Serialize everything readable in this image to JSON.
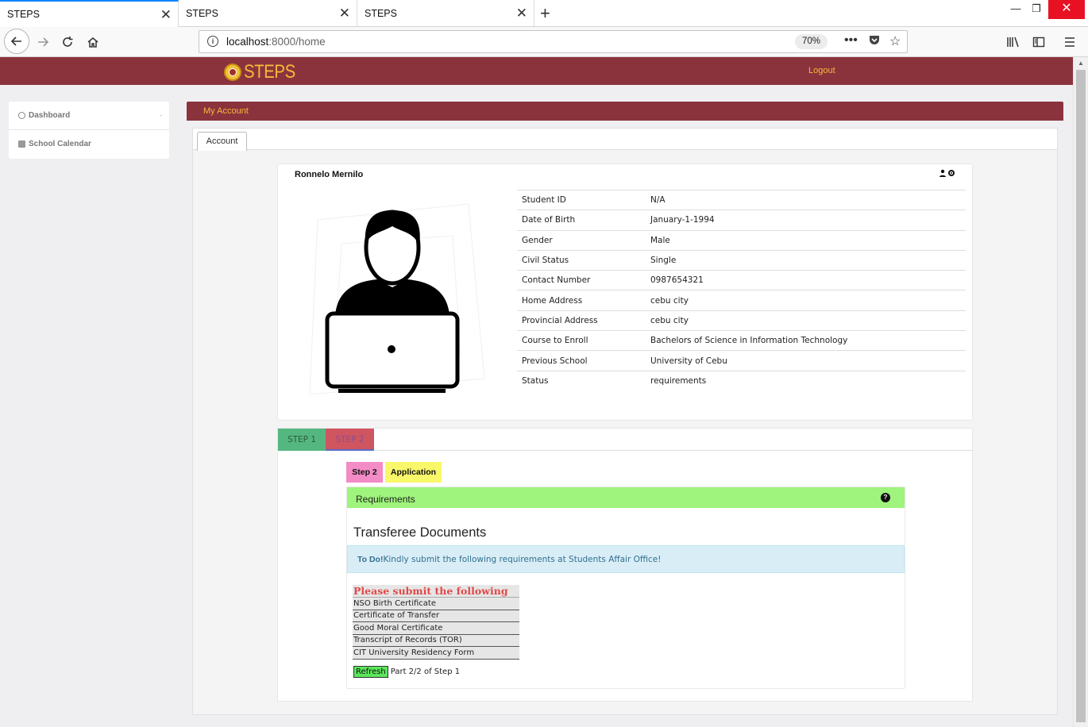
{
  "browser": {
    "tabs": [
      {
        "title": "STEPS",
        "active": true
      },
      {
        "title": "STEPS",
        "active": false
      },
      {
        "title": "STEPS",
        "active": false
      }
    ],
    "url_host": "localhost",
    "url_rest": ":8000/home",
    "zoom": "70%"
  },
  "header": {
    "logo_text": "STEPS",
    "logout": "Logout"
  },
  "sidebar": {
    "items": [
      {
        "label": "Dashboard"
      },
      {
        "label": "School Calendar"
      }
    ]
  },
  "panel": {
    "title": "My Account",
    "tab": "Account"
  },
  "profile": {
    "name": "Ronnelo Mernilo",
    "fields": [
      {
        "label": "Student ID",
        "value": "N/A"
      },
      {
        "label": "Date of Birth",
        "value": "January-1-1994"
      },
      {
        "label": "Gender",
        "value": "Male"
      },
      {
        "label": "Civil Status",
        "value": "Single"
      },
      {
        "label": "Contact Number",
        "value": "0987654321"
      },
      {
        "label": "Home Address",
        "value": "cebu city"
      },
      {
        "label": "Provincial Address",
        "value": "cebu city"
      },
      {
        "label": "Course to Enroll",
        "value": "Bachelors of Science in Information Technology"
      },
      {
        "label": "Previous School",
        "value": "University of Cebu"
      },
      {
        "label": "Status",
        "value": "requirements"
      }
    ]
  },
  "steps": {
    "tabs": [
      "STEP 1",
      "STEP 2"
    ],
    "chips": [
      "Step 2",
      "Application"
    ],
    "requirements_title": "Requirements",
    "section_title": "Transferee Documents",
    "todo_label": "To Do!",
    "todo_text": "Kindly submit the following requirements at Students Affair Office!",
    "list_header": "Please submit the following",
    "list": [
      "NSO Birth Certificate",
      "Certificate of Transfer",
      "Good Moral Certificate",
      "Transcript of Records (TOR)",
      "CIT University Residency Form"
    ],
    "refresh_label": "Refresh",
    "part_text": "Part 2/2 of Step 1"
  }
}
